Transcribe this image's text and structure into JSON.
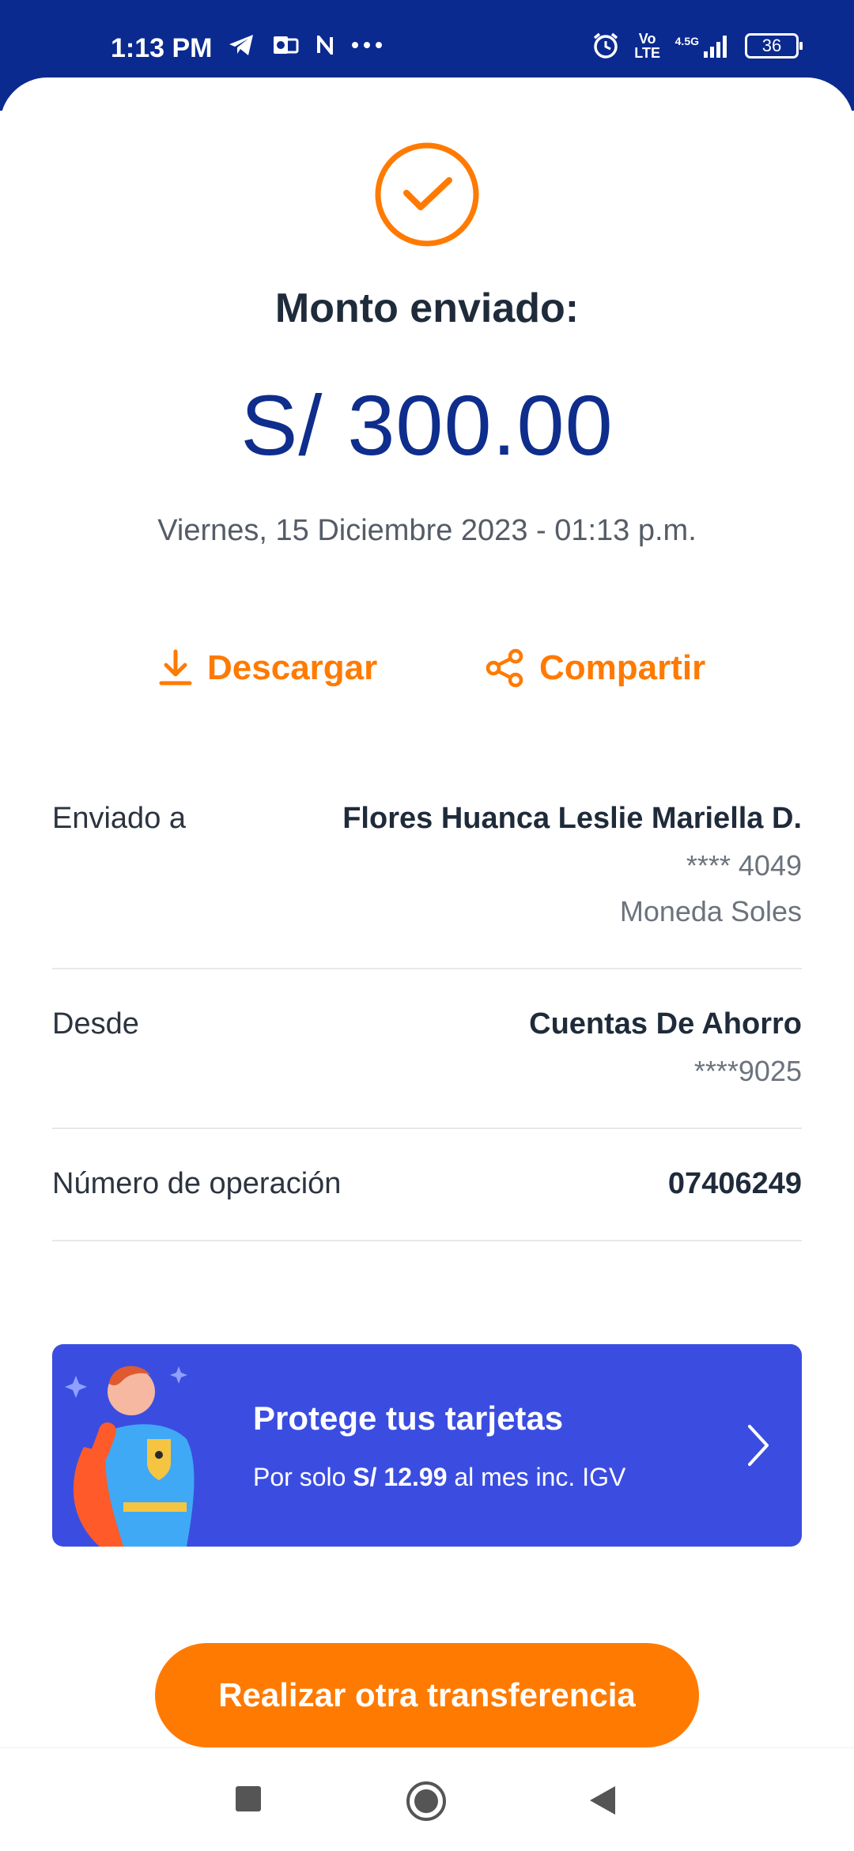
{
  "status_bar": {
    "time": "1:13 PM",
    "icons_left": [
      "telegram-icon",
      "outlook-icon",
      "n-icon",
      "more-dots-icon"
    ],
    "volte": "Vo LTE",
    "network": "4.5G",
    "battery": "36"
  },
  "receipt": {
    "title": "Monto enviado:",
    "amount": "S/ 300.00",
    "date": "Viernes, 15 Diciembre 2023 - 01:13 p.m."
  },
  "actions": {
    "download_label": "Descargar",
    "share_label": "Compartir"
  },
  "details": {
    "sent_to": {
      "label": "Enviado a",
      "name": "Flores Huanca Leslie Mariella D.",
      "account": "**** 4049",
      "currency": "Moneda Soles"
    },
    "from": {
      "label": "Desde",
      "account_type": "Cuentas De Ahorro",
      "account": "****9025"
    },
    "operation": {
      "label": "Número de operación",
      "number": "07406249"
    }
  },
  "promo": {
    "title": "Protege tus tarjetas",
    "subtitle_prefix": "Por solo ",
    "price": "S/ 12.99",
    "subtitle_suffix": " al mes inc. IGV"
  },
  "cta": {
    "label": "Realizar otra transferencia"
  },
  "colors": {
    "brand_blue": "#0f2d8c",
    "status_bar": "#0b2a8f",
    "accent_orange": "#ff7a00",
    "promo_bg": "#3b4de0"
  }
}
